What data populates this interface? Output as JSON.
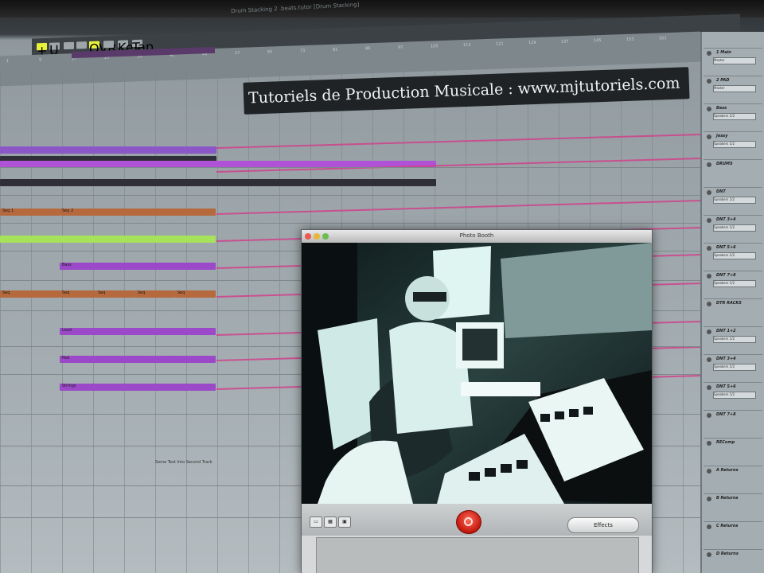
{
  "window": {
    "document_title": "Drum Stacking 2 .beats.tutor [Drum Stacking]"
  },
  "transport": {
    "buttons": [
      "+",
      "U",
      "",
      "",
      "OVR",
      "",
      "Key",
      "Tap"
    ],
    "accent_color": "#e8f23a"
  },
  "ruler": {
    "marks": [
      "1",
      "9",
      "17",
      "25",
      "33",
      "41",
      "49",
      "57",
      "65",
      "73",
      "81",
      "89",
      "97",
      "105",
      "113",
      "121",
      "129",
      "137",
      "145",
      "153",
      "161"
    ]
  },
  "banner": {
    "text": "Tutoriels de Production Musicale :  www.mjtutoriels.com"
  },
  "arrangement": {
    "clips": [
      {
        "label": "",
        "color": "#8a56c8"
      },
      {
        "label": "",
        "color": "#2f2f39"
      },
      {
        "label": "",
        "color": "#b052d8"
      },
      {
        "label": "",
        "color": "#2f2f39"
      },
      {
        "label": "Seq 1",
        "color": "#b5693d"
      },
      {
        "label": "Seq 2",
        "color": "#b5693d"
      },
      {
        "label": "",
        "color": "#a6e35b"
      },
      {
        "label": "",
        "color": "#a6e35b"
      },
      {
        "label": "Bass",
        "color": "#9b49c8"
      },
      {
        "label": "Seq",
        "color": "#b5693d"
      },
      {
        "label": "Seq",
        "color": "#b5693d"
      },
      {
        "label": "Seq",
        "color": "#b5693d"
      },
      {
        "label": "Seq",
        "color": "#b5693d"
      },
      {
        "label": "Seq",
        "color": "#b5693d"
      },
      {
        "label": "Lead",
        "color": "#9b49c8"
      },
      {
        "label": "Pad",
        "color": "#9b49c8"
      },
      {
        "label": "Strings",
        "color": "#9b49c8"
      }
    ],
    "note_label": "Some Text Into Second Track",
    "automation_color": "#d0418c"
  },
  "mixer": {
    "tracks": [
      {
        "name": "1 Main",
        "select": "Master"
      },
      {
        "name": "2 PAD",
        "select": "Master"
      },
      {
        "name": "Bass",
        "select": "Speakers 1/2"
      },
      {
        "name": "Jessy",
        "select": "Speakers 1/2"
      },
      {
        "name": "DRUMS",
        "select": ""
      },
      {
        "name": "DNT",
        "select": "Speakers 1/2"
      },
      {
        "name": "DNT 3+4",
        "select": "Speakers 1/2"
      },
      {
        "name": "DNT 5+6",
        "select": "Speakers 1/2"
      },
      {
        "name": "DNT 7+8",
        "select": "Speakers 1/2"
      },
      {
        "name": "DTR RACKS",
        "select": ""
      },
      {
        "name": "DNT 1+2",
        "select": "Speakers 1/2"
      },
      {
        "name": "DNT 3+4",
        "select": "Speakers 1/2"
      },
      {
        "name": "DNT 5+6",
        "select": "Speakers 1/2"
      },
      {
        "name": "DNT 7+8",
        "select": ""
      },
      {
        "name": "REComp",
        "select": ""
      },
      {
        "name": "A Returns",
        "select": ""
      },
      {
        "name": "B Returns",
        "select": ""
      },
      {
        "name": "C Returns",
        "select": ""
      },
      {
        "name": "D Returns",
        "select": ""
      }
    ]
  },
  "photobooth": {
    "title": "Photo Booth",
    "effects_label": "Effects",
    "mode_buttons": [
      "▭",
      "▦",
      "▣"
    ]
  }
}
